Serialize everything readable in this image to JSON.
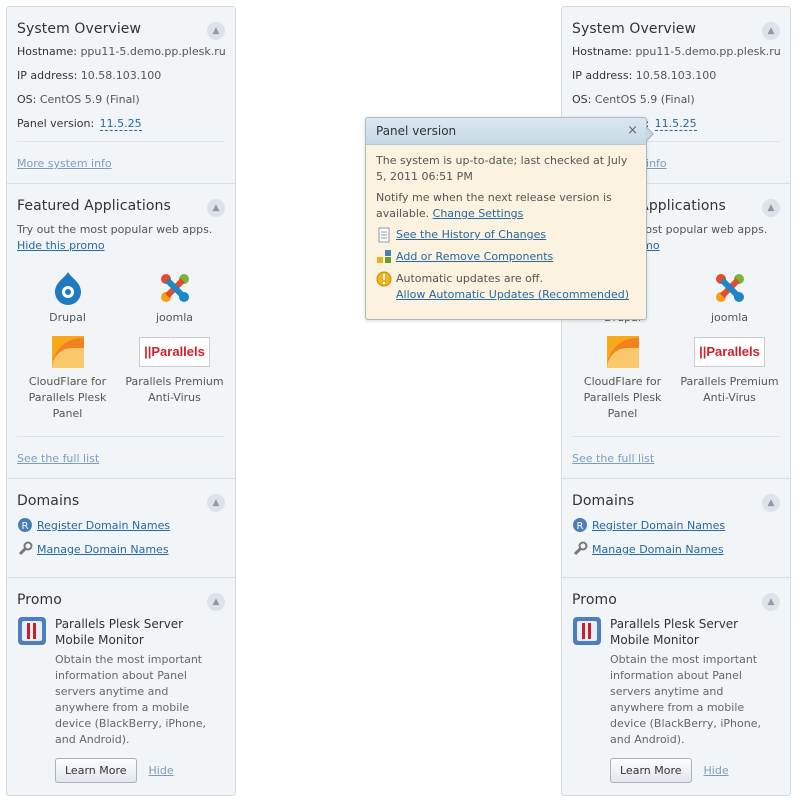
{
  "system_overview": {
    "title": "System Overview",
    "hostname_label": "Hostname:",
    "hostname": "ppu11-5.demo.pp.plesk.ru",
    "ip_label": "IP address:",
    "ip": "10.58.103.100",
    "os_label": "OS:",
    "os": "CentOS 5.9 (Final)",
    "panel_label": "Panel version:",
    "panel_version": "11.5.25",
    "more_link": "More system info"
  },
  "featured": {
    "title": "Featured Applications",
    "intro": "Try out the most popular web apps.",
    "hide_link": "Hide this promo",
    "apps": [
      {
        "name": "Drupal",
        "icon": "drupal-icon"
      },
      {
        "name": "joomla",
        "icon": "joomla-icon"
      },
      {
        "name": "CloudFlare for Parallels Plesk Panel",
        "icon": "cloudflare-icon"
      },
      {
        "name": "Parallels Premium Anti-Virus",
        "icon": "parallels-icon"
      }
    ],
    "parallels_logo_text": "||Parallels",
    "full_list_link": "See the full list"
  },
  "domains": {
    "title": "Domains",
    "register_link": "Register Domain Names",
    "manage_link": "Manage Domain Names"
  },
  "promo": {
    "title": "Promo",
    "item_title": "Parallels Plesk Server Mobile Monitor",
    "description": "Obtain the most important information about Panel servers anytime and anywhere from a mobile device (BlackBerry, iPhone, and Android).",
    "learn_more": "Learn More",
    "hide": "Hide"
  },
  "popup": {
    "title": "Panel version",
    "close": "×",
    "status": "The system is up-to-date; last checked at July 5, 2011 06:51 PM",
    "notify_text": "Notify me when the next release version is available.",
    "change_settings": "Change Settings",
    "history_link": "See the History of Changes",
    "components_link": "Add or Remove Components",
    "updates_off": "Automatic updates are off.",
    "allow_updates": "Allow Automatic Updates (Recommended)"
  },
  "colors": {
    "link": "#2768a5",
    "muted_link": "#7e9cbc",
    "sidebar_bg": "#f2f5f7",
    "popup_bg": "#fbf2df",
    "popup_header": "#c7d9e6"
  }
}
